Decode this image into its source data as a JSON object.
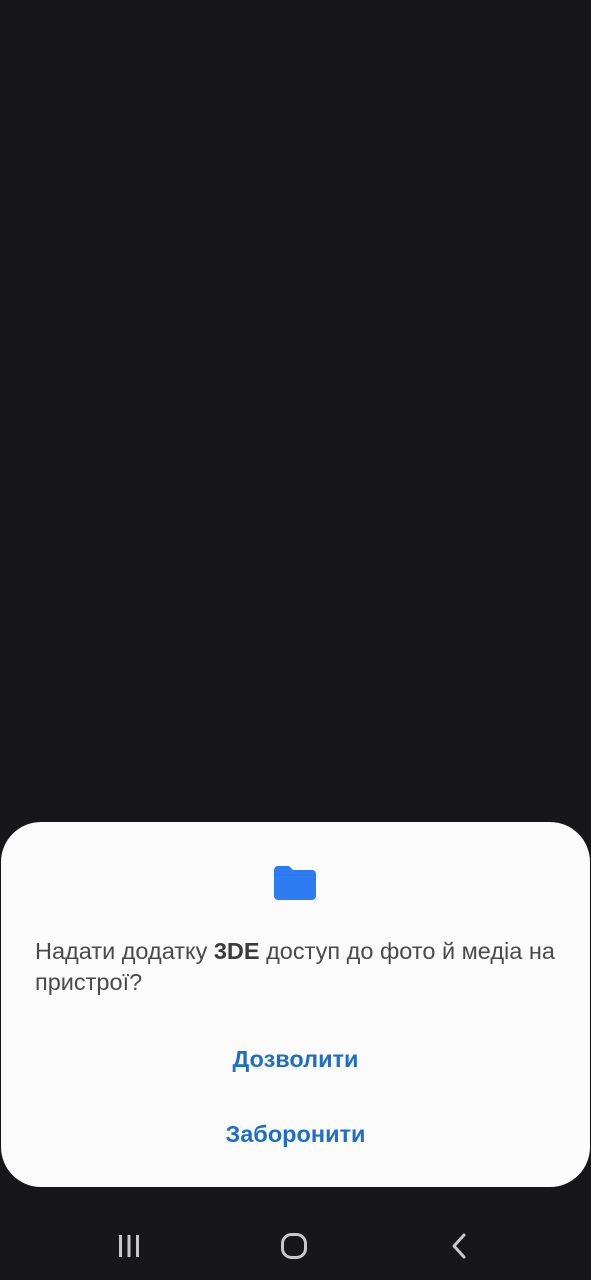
{
  "dialog": {
    "icon": "folder-icon",
    "message_prefix": "Надати додатку ",
    "app_name": "3DE",
    "message_suffix": " доступ до фото й медіа на пристрої?",
    "allow_label": "Дозволити",
    "deny_label": "Заборонити"
  },
  "navigation_bar": {
    "recent_icon": "recent-apps-icon",
    "home_icon": "home-icon",
    "back_icon": "back-icon"
  },
  "colors": {
    "background": "#171618",
    "dialog_background": "#fbfbfb",
    "accent": "#1f6ec6",
    "folder": "#2d7cf1",
    "nav_icons": "#c8c8c8"
  }
}
